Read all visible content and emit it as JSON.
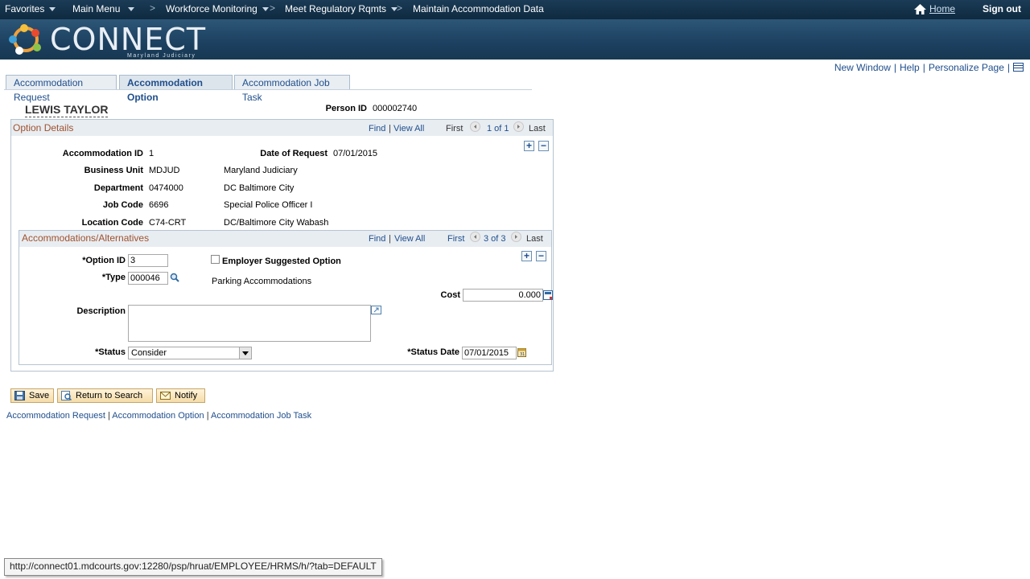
{
  "nav": {
    "favorites": "Favorites",
    "main_menu": "Main Menu",
    "workforce": "Workforce Monitoring",
    "regulatory": "Meet Regulatory Rqmts",
    "current": "Maintain Accommodation Data",
    "home": "Home",
    "sign_out": "Sign out"
  },
  "banner": {
    "logo": "CONNECT",
    "subtitle": "Maryland Judiciary"
  },
  "page_links": {
    "new_window": "New Window",
    "help": "Help",
    "personalize": "Personalize Page"
  },
  "tabs": [
    "Accommodation Request",
    "Accommodation Option",
    "Accommodation Job Task"
  ],
  "header": {
    "name": "LEWIS TAYLOR",
    "person_id_label": "Person ID",
    "person_id": "000002740"
  },
  "option_details": {
    "title": "Option Details",
    "find": "Find",
    "view_all": "View All",
    "first": "First",
    "count": "1 of 1",
    "last": "Last",
    "accommodation_id_label": "Accommodation ID",
    "accommodation_id": "1",
    "date_of_request_label": "Date of Request",
    "date_of_request": "07/01/2015",
    "business_unit_label": "Business Unit",
    "business_unit": "MDJUD",
    "business_unit_desc": "Maryland Judiciary",
    "department_label": "Department",
    "department": "0474000",
    "department_desc": "DC Baltimore City",
    "job_code_label": "Job Code",
    "job_code": "6696",
    "job_code_desc": "Special Police Officer I",
    "location_code_label": "Location Code",
    "location_code": "C74-CRT",
    "location_code_desc": "DC/Baltimore City Wabash"
  },
  "alternatives": {
    "title": "Accommodations/Alternatives",
    "find": "Find",
    "view_all": "View All",
    "first": "First",
    "count": "3 of 3",
    "last": "Last",
    "option_id_label": "*Option ID",
    "option_id": "3",
    "employer_suggested_label": "Employer Suggested Option",
    "type_label": "*Type",
    "type": "000046",
    "type_desc": "Parking Accommodations",
    "cost_label": "Cost",
    "cost": "0.000",
    "description_label": "Description",
    "description": "",
    "status_label": "*Status",
    "status": "Consider",
    "status_date_label": "*Status Date",
    "status_date": "07/01/2015"
  },
  "buttons": {
    "save": "Save",
    "return": "Return to Search",
    "notify": "Notify"
  },
  "bottom_links": [
    "Accommodation Request",
    "Accommodation Option",
    "Accommodation Job Task"
  ],
  "status_url": "http://connect01.mdcourts.gov:12280/psp/hruat/EMPLOYEE/HRMS/h/?tab=DEFAULT"
}
